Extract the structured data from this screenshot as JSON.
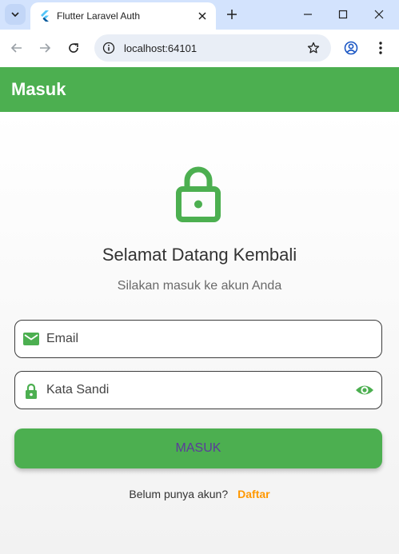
{
  "browser": {
    "tab_title": "Flutter Laravel Auth",
    "url": "localhost:64101",
    "icons": {
      "tab_search": "chevron-down-icon",
      "favicon": "flutter-icon",
      "tab_close": "close-icon",
      "new_tab": "plus-icon",
      "minimize": "minimize-icon",
      "maximize": "maximize-icon",
      "close_window": "close-icon",
      "back": "arrow-left-icon",
      "forward": "arrow-right-icon",
      "reload": "reload-icon",
      "site_info": "info-icon",
      "bookmark": "star-icon",
      "profile": "account-icon",
      "menu": "more-vertical-icon"
    }
  },
  "appbar": {
    "title": "Masuk",
    "color": "#4caf50"
  },
  "login": {
    "heading": "Selamat Datang Kembali",
    "subheading": "Silakan masuk ke akun Anda",
    "email_placeholder": "Email",
    "password_placeholder": "Kata Sandi",
    "submit_label": "MASUK",
    "signup_prompt": "Belum punya akun?",
    "signup_link": "Daftar",
    "icons": {
      "hero": "lock-icon",
      "email": "mail-icon",
      "password": "lock-icon",
      "toggle_visibility": "eye-icon"
    },
    "colors": {
      "accent": "#4caf50",
      "link": "#ff9800",
      "button_text": "#5b3b9a"
    }
  }
}
